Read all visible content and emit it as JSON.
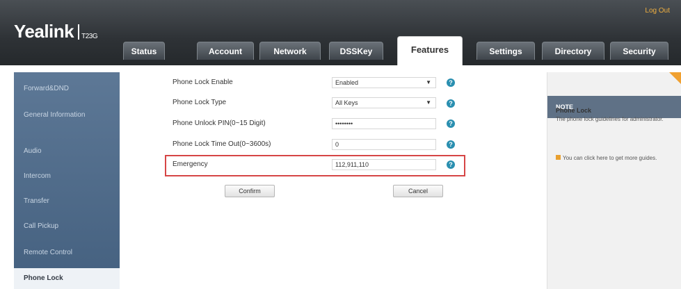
{
  "header": {
    "logo": "Yealink",
    "model": "T23G",
    "logout": "Log Out"
  },
  "tabs": [
    {
      "label": "Status"
    },
    {
      "label": "Account"
    },
    {
      "label": "Network"
    },
    {
      "label": "DSSKey"
    },
    {
      "label": "Features",
      "active": true
    },
    {
      "label": "Settings"
    },
    {
      "label": "Directory"
    },
    {
      "label": "Security"
    }
  ],
  "sidebar": {
    "items": [
      {
        "label": "Forward&DND"
      },
      {
        "label": "General Information"
      },
      {
        "label": "Audio"
      },
      {
        "label": "Intercom"
      },
      {
        "label": "Transfer"
      },
      {
        "label": "Call Pickup"
      },
      {
        "label": "Remote Control"
      },
      {
        "label": "Phone Lock",
        "active": true
      }
    ]
  },
  "form": {
    "rows": [
      {
        "label": "Phone Lock Enable",
        "value": "Enabled",
        "type": "select"
      },
      {
        "label": "Phone Lock Type",
        "value": "All Keys",
        "type": "select"
      },
      {
        "label": "Phone Unlock PIN(0~15 Digit)",
        "value": "••••••••",
        "type": "password"
      },
      {
        "label": "Phone Lock Time Out(0~3600s)",
        "value": "0",
        "type": "text"
      },
      {
        "label": "Emergency",
        "value": "112,911,110",
        "type": "text"
      }
    ],
    "help_glyph": "?",
    "confirm_label": "Confirm",
    "cancel_label": "Cancel"
  },
  "note": {
    "heading": "NOTE",
    "title": "Phone Lock",
    "body": "The phone lock guidelines for administrator.",
    "link_text": "You can click here to get more guides."
  },
  "colors": {
    "highlight": "#d64545",
    "help": "#2a8fb0",
    "accent": "#f0a030"
  }
}
